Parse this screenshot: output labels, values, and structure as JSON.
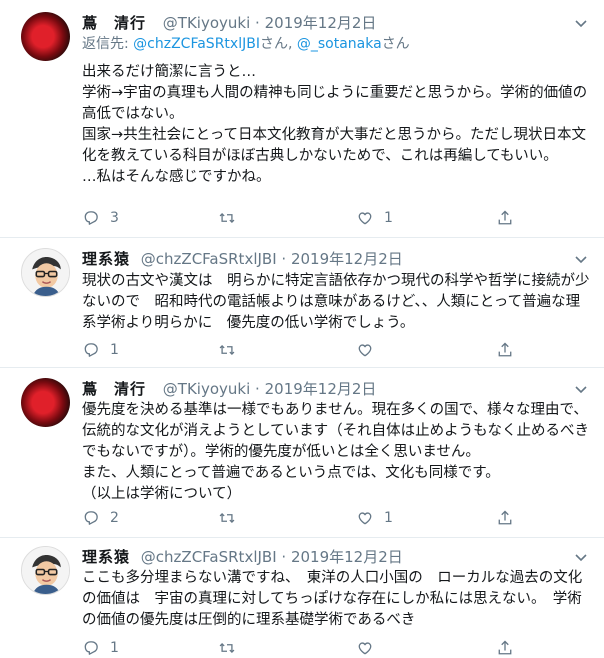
{
  "tweets": [
    {
      "name": "蔦　清行",
      "handle": "@TKiyoyuki",
      "dot": "·",
      "date": "2019年12月2日",
      "reply_prefix": "返信先: ",
      "reply_user1": "@chzZCFaSRtxlJBI",
      "reply_mid": "さん, ",
      "reply_user2": "@_sotanaka",
      "reply_suffix": "さん",
      "body": "出来るだけ簡潔に言うと…\n学術→宇宙の真理も人間の精神も同じように重要だと思うから。学術的価値の高低ではない。\n国家→共生社会にとって日本文化教育が大事だと思うから。ただし現状日本文化を教えている科目がほぼ古典しかないためで、これは再編してもいい。\n…私はそんな感じですかね。",
      "reply_count": "3",
      "retweet_count": "",
      "like_count": "1"
    },
    {
      "name": "理系猿",
      "handle": "@chzZCFaSRtxlJBI",
      "dot": "·",
      "date": "2019年12月2日",
      "body": "現状の古文や漢文は　明らかに特定言語依存かつ現代の科学や哲学に接続が少ないので　昭和時代の電話帳よりは意味があるけど、、人類にとって普遍な理系学術より明らかに　優先度の低い学術でしょう。",
      "reply_count": "1",
      "retweet_count": "",
      "like_count": ""
    },
    {
      "name": "蔦　清行",
      "handle": "@TKiyoyuki",
      "dot": "·",
      "date": "2019年12月2日",
      "body": "優先度を決める基準は一様でもありません。現在多くの国で、様々な理由で、伝統的な文化が消えようとしています（それ自体は止めようもなく止めるべきでもないですが）。学術的優先度が低いとは全く思いません。\nまた、人類にとって普遍であるという点では、文化も同様です。\n（以上は学術について）",
      "reply_count": "2",
      "retweet_count": "",
      "like_count": "1"
    },
    {
      "name": "理系猿",
      "handle": "@chzZCFaSRtxlJBI",
      "dot": "·",
      "date": "2019年12月2日",
      "body": "ここも多分埋まらない溝ですね、　東洋の人口小国の　ローカルな過去の文化の価値は　宇宙の真理に対してちっぽけな存在にしか私には思えない。　学術の価値の優先度は圧倒的に理系基礎学術であるべき",
      "reply_count": "1",
      "retweet_count": "",
      "like_count": ""
    }
  ],
  "icons": {
    "reply": "reply-icon",
    "retweet": "retweet-icon",
    "like": "heart-icon",
    "share": "share-icon",
    "menu": "chevron-down-icon"
  },
  "colors": {
    "link": "#1b95e0",
    "muted": "#657786",
    "text": "#14171a",
    "divider": "#e6ecf0"
  }
}
